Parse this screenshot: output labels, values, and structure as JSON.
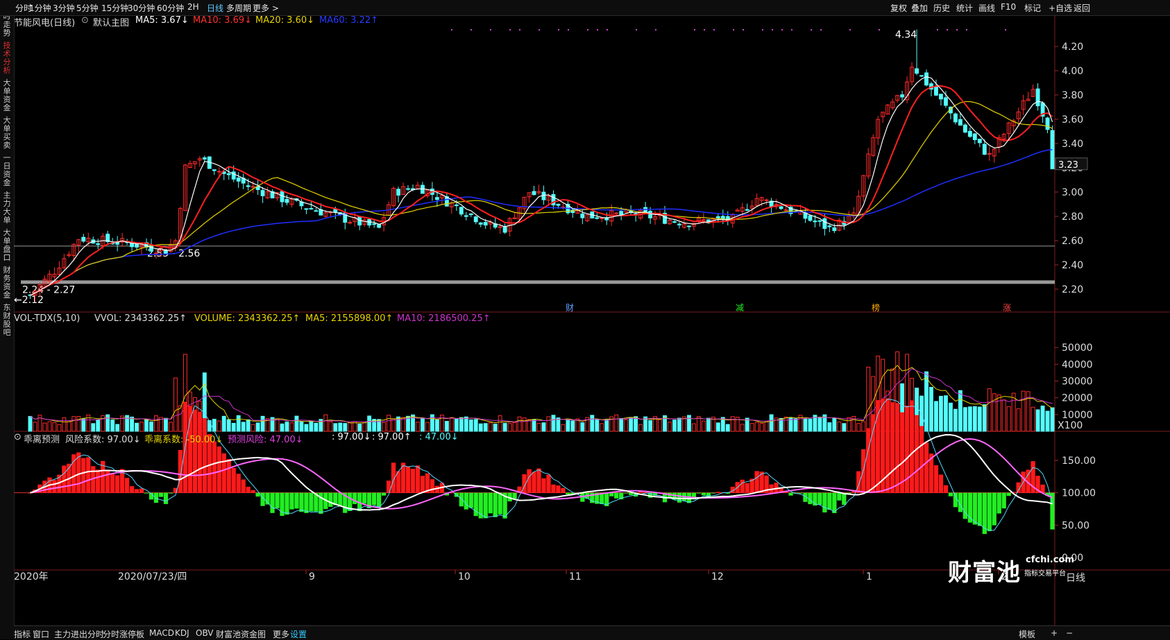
{
  "topbar": {
    "left_items": [
      "分时",
      "1分钟",
      "3分钟",
      "5分钟",
      "15分钟",
      "30分钟",
      "60分钟",
      "2H",
      "日线",
      "多周期",
      "更多 >"
    ],
    "active_item": "日线",
    "right_items": [
      "复权",
      "叠加",
      "历史",
      "统计",
      "画线",
      "F10",
      "标记",
      "+自选",
      "返回"
    ]
  },
  "leftbar": {
    "tabs": [
      "分时走势",
      "技术分析",
      "大单资金",
      "大单买卖",
      "一日资金",
      "主力大单",
      "大单盘口",
      "财务资金",
      "东财股吧"
    ],
    "active_tab": "技术分析"
  },
  "main": {
    "stock_name": "节能风电(日线)",
    "template": "默认主图",
    "ma5": "MA5: 3.67↓",
    "ma10": "MA10: 3.69↓",
    "ma20": "MA20: 3.60↓",
    "ma60": "MA60: 3.22↑",
    "y_ticks": [
      "4.20",
      "4.00",
      "3.80",
      "3.60",
      "3.40",
      "3.20",
      "3.00",
      "2.80",
      "2.60",
      "2.40",
      "2.20"
    ],
    "last_price": "3.23",
    "high_label": "4.34",
    "low_label": "2.12",
    "support1": "2.55 - 2.56",
    "support2": "2.24 - 2.27",
    "markers": [
      "财",
      "减",
      "榜",
      "涨"
    ]
  },
  "volume": {
    "title": "VOL-TDX(5,10)",
    "vvol": "VVOL: 2343362.25↑",
    "volume": "VOLUME: 2343362.25↑",
    "ma5": "MA5: 2155898.00↑",
    "ma10": "MA10: 2186500.25↑",
    "y_ticks": [
      "50000",
      "40000",
      "30000",
      "20000",
      "10000"
    ],
    "unit": "X100"
  },
  "indicator": {
    "title": "乖离预测",
    "risk": "风险系数: 97.00↓",
    "bias": "乖离系数: -50.00↓",
    "predict": "预测风险: 47.00↓",
    "v1": ": 97.00↓",
    "v2": ": 97.00↑",
    "v3": ": 47.00↓",
    "y_ticks": [
      "150.00",
      "100.00",
      "50.00",
      "0.00"
    ]
  },
  "xaxis": {
    "labels": [
      "2020年",
      "2020/07/23/四",
      "9",
      "10",
      "11",
      "12",
      "1",
      "2"
    ],
    "period": "日线"
  },
  "bottombar": {
    "items": [
      "指标",
      "窗口",
      "主力进出分时",
      "分时涨停板",
      "MACD",
      "KDJ",
      "OBV",
      "财富池资金图",
      "更多",
      "设置"
    ],
    "active_item": "设置",
    "right_items": [
      "模板",
      "+",
      "−"
    ]
  },
  "watermark": {
    "brand": "财富池",
    "domain": "cfchi.com",
    "tagline": "指标交易平台"
  },
  "colors": {
    "up": "#ff2b2b",
    "down": "#54ffff",
    "ma5": "#ffffff",
    "ma10": "#ff2020",
    "ma20": "#e6d400",
    "ma60": "#1f2fff",
    "vol_ma10": "#cc33cc",
    "green_bar": "#22ee22"
  }
}
